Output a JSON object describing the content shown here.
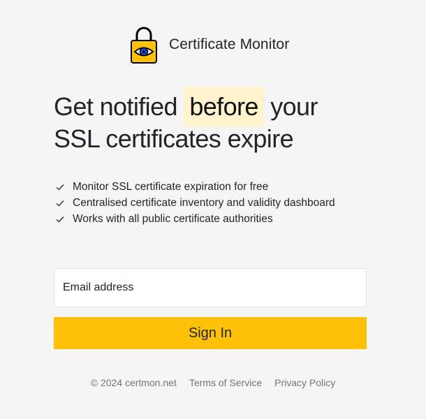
{
  "brand": {
    "name": "Certificate Monitor",
    "logo_icon": "padlock-eye-icon",
    "logo_color": "#ffc107"
  },
  "headline": {
    "before": "Get notified",
    "highlight": "before",
    "after": "your",
    "line2": "SSL certificates expire",
    "highlight_color": "#fff3cd"
  },
  "features": [
    {
      "icon": "checkmark-icon",
      "text": "Monitor SSL certificate expiration for free"
    },
    {
      "icon": "checkmark-icon",
      "text": "Centralised certificate inventory and validity dashboard"
    },
    {
      "icon": "checkmark-icon",
      "text": "Works with all public certificate authorities"
    }
  ],
  "form": {
    "email_placeholder": "Email address",
    "email_value": "",
    "submit_label": "Sign In",
    "accent": "#ffc107"
  },
  "footer": {
    "copyright": "© 2024 certmon.net",
    "terms": "Terms of Service",
    "privacy": "Privacy Policy"
  }
}
